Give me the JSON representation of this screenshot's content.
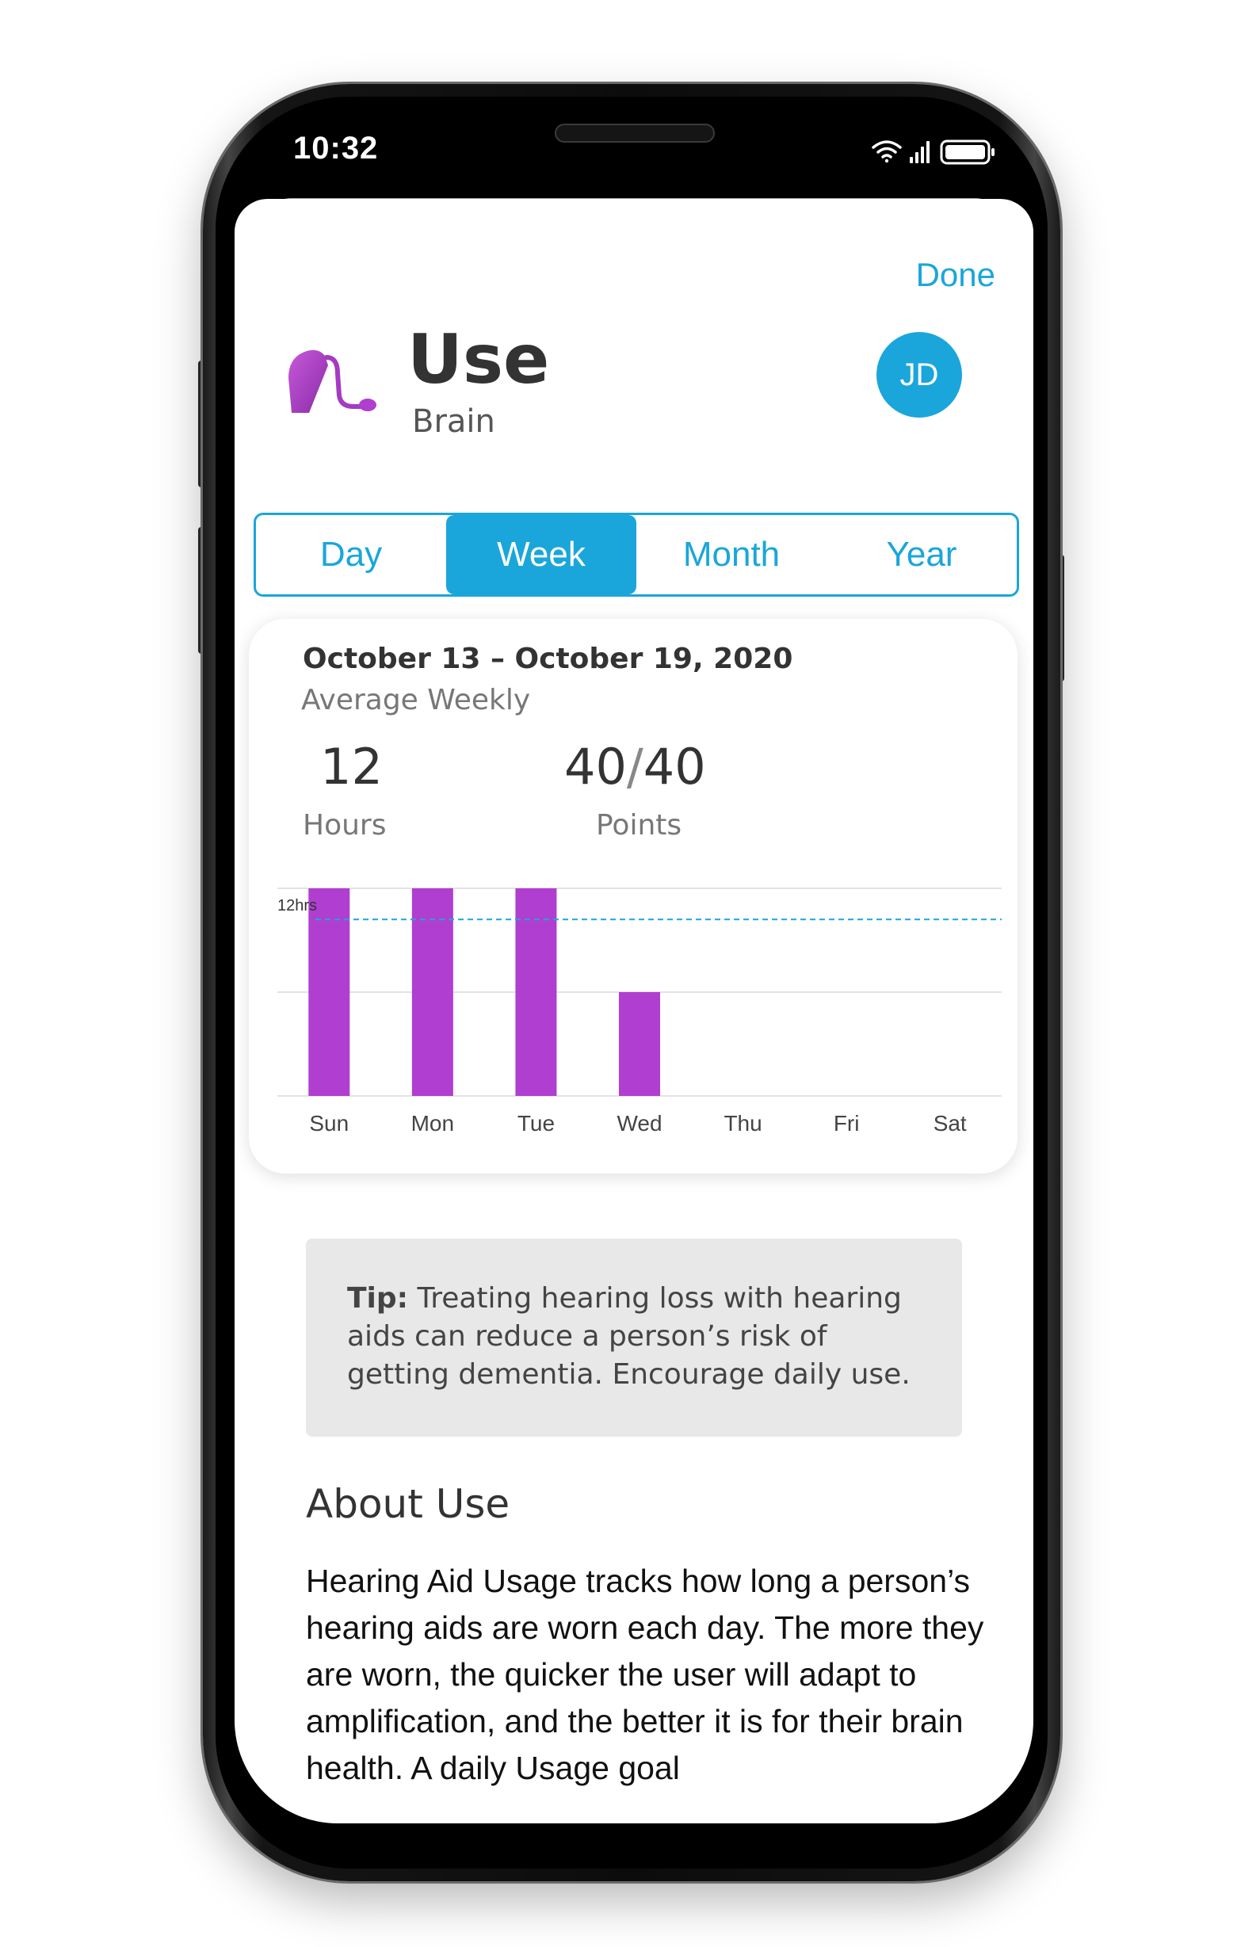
{
  "status_bar": {
    "time": "10:32",
    "icons": [
      "wifi-icon",
      "cellular-signal-icon",
      "battery-icon"
    ]
  },
  "header": {
    "done_label": "Done",
    "title": "Use",
    "subtitle": "Brain",
    "avatar_initials": "JD",
    "icon": "hearing-aid-icon"
  },
  "period_tabs": {
    "items": [
      {
        "label": "Day"
      },
      {
        "label": "Week"
      },
      {
        "label": "Month"
      },
      {
        "label": "Year"
      }
    ],
    "selected": "Week"
  },
  "summary": {
    "date_range": "October 13 – October 19, 2020",
    "average_label": "Average Weekly",
    "hours_value": "12",
    "hours_label": "Hours",
    "points_earned": "40",
    "points_separator": "/",
    "points_total": "40",
    "points_label": "Points"
  },
  "chart_data": {
    "type": "bar",
    "categories": [
      "Sun",
      "Mon",
      "Tue",
      "Wed",
      "Thu",
      "Fri",
      "Sat"
    ],
    "values": [
      20,
      20,
      20,
      10,
      0,
      0,
      0
    ],
    "ylim": [
      0,
      20
    ],
    "goal_line": {
      "value": 17,
      "label": "12hrs"
    },
    "grid": true,
    "colors": {
      "bar": "#b03ed0",
      "goal": "#1aa6db",
      "grid": "#e3e3e3"
    }
  },
  "tip": {
    "label": "Tip:",
    "text": "Treating hearing loss with hearing aids can reduce a person’s risk of getting dementia. Encourage daily use."
  },
  "about": {
    "heading": "About Use",
    "body": "Hearing Aid Usage tracks how long a person’s hearing aids are worn each day. The more they are worn, the quicker the user will adapt to amplification, and the better it is for their brain health. A daily Usage goal"
  },
  "colors": {
    "accent": "#1aa6db",
    "brand_purple": "#b03ed0",
    "text_dark": "#333333",
    "text_muted": "#777777"
  }
}
